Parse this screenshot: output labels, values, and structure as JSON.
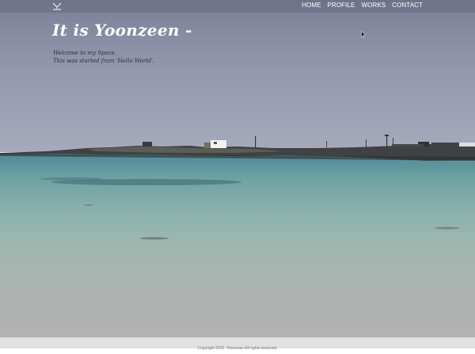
{
  "nav": {
    "items": [
      "HOME",
      "PROFILE",
      "WORKS",
      "CONTACT"
    ]
  },
  "hero": {
    "title": "It is Yoonzeen -",
    "subtitle_line1": "Welcome to my Space.",
    "subtitle_line2": "This was started from 'Hello World'."
  },
  "footer": {
    "text": "Copyright 2022. Yoonzeen All rights reserved."
  },
  "colors": {
    "sky": "#8e93a9",
    "sea_top": "#4f8a96",
    "sand": "#b2b2b3",
    "footer_bg": "#e1e1e1"
  }
}
